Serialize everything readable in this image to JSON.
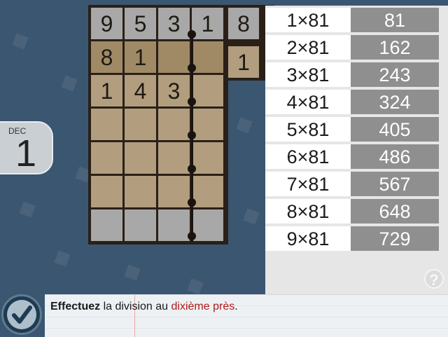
{
  "date": {
    "month": "DEC",
    "day": "1"
  },
  "division": {
    "dividend_digits": [
      "9",
      "5",
      "3",
      "1"
    ],
    "divisor_digits": [
      "8"
    ],
    "quotient_digits": [
      "1"
    ],
    "work_rows": [
      [
        "8",
        "1",
        "",
        ""
      ],
      [
        "1",
        "4",
        "3",
        ""
      ]
    ]
  },
  "multiplication_table": {
    "rows": [
      {
        "label": "1×81",
        "value": "81"
      },
      {
        "label": "2×81",
        "value": "162"
      },
      {
        "label": "3×81",
        "value": "243"
      },
      {
        "label": "4×81",
        "value": "324"
      },
      {
        "label": "5×81",
        "value": "405"
      },
      {
        "label": "6×81",
        "value": "486"
      },
      {
        "label": "7×81",
        "value": "567"
      },
      {
        "label": "8×81",
        "value": "648"
      },
      {
        "label": "9×81",
        "value": "729"
      }
    ]
  },
  "help": {
    "icon": "question-mark-icon",
    "label": "?"
  },
  "instruction": {
    "bold": "Effectuez",
    "middle": " la division au ",
    "highlight": "dixième près",
    "end": "."
  },
  "validate_button": {
    "icon": "check-icon"
  },
  "colors": {
    "background": "#3b5670",
    "highlight_text": "#b01a1a",
    "table_value_bg": "#8f8f8f"
  }
}
